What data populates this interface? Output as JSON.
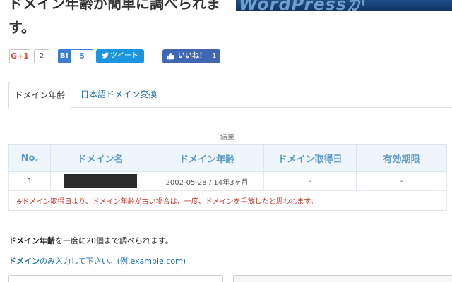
{
  "header": {
    "title": "ドメイン年齢が簡単に調べられます。",
    "banner_text": "WordPressが"
  },
  "share": {
    "gplus_label": "G+1",
    "gplus_count": "2",
    "hatena_label": "B!",
    "hatena_count": "5",
    "tweet_label": "ツイート",
    "fb_label": "いいね！",
    "fb_count": "1",
    "colors": {
      "gplus": "#dd4b39",
      "hatena": "#3c7dd1",
      "twitter": "#1b95e0",
      "facebook": "#4267b2"
    }
  },
  "tabs": [
    {
      "label": "ドメイン年齢",
      "active": true
    },
    {
      "label": "日本語ドメイン変換",
      "active": false
    }
  ],
  "result": {
    "label": "結果",
    "columns": [
      "No.",
      "ドメイン名",
      "ドメイン年齢",
      "ドメイン取得日",
      "有効期限"
    ],
    "rows": [
      {
        "no": "1",
        "domain": "",
        "age": "2002-05-28 / 14年3ヶ月",
        "acquired": "-",
        "expires": "-"
      }
    ],
    "note": "※ドメイン取得日より、ドメイン年齢が古い場合は、一度、ドメインを手放したと思われます。"
  },
  "info": {
    "line1_bold": "ドメイン年齢",
    "line1_rest": "を一度に20個まで調べられます。",
    "line2_bold": "ドメイン",
    "line2_rest": "のみ入力して下さい。(例.example.com)"
  }
}
